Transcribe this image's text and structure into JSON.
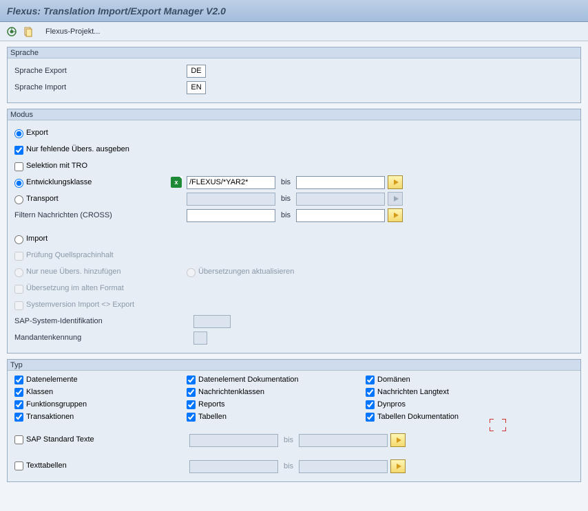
{
  "title": "Flexus: Translation Import/Export Manager V2.0",
  "toolbar": {
    "project_label": "Flexus-Projekt..."
  },
  "groups": {
    "sprache": "Sprache",
    "modus": "Modus",
    "typ": "Typ"
  },
  "sprache": {
    "export_label": "Sprache Export",
    "export_value": "DE",
    "import_label": "Sprache Import",
    "import_value": "EN"
  },
  "modus": {
    "export_radio": "Export",
    "only_missing": "Nur fehlende Übers. ausgeben",
    "sel_tro": "Selektion mit TRO",
    "devclass_radio": "Entwicklungsklasse",
    "devclass_value": "/FLEXUS/*YAR2*",
    "transport_radio": "Transport",
    "filter_msg_label": "Filtern Nachrichten (CROSS)",
    "bis": "bis",
    "import_radio": "Import",
    "check_src": "Prüfung Quellsprachinhalt",
    "only_new": "Nur neue Übers. hinzufügen",
    "upd_trans": "Übersetzungen aktualisieren",
    "old_format": "Übersetzung im alten Format",
    "sysver": "Systemversion Import <> Export",
    "sap_sys_id_label": "SAP-System-Identifikation",
    "mandant_label": "Mandantenkennung"
  },
  "typ": {
    "c1": [
      "Datenelemente",
      "Klassen",
      "Funktionsgruppen",
      "Transaktionen"
    ],
    "c2": [
      "Datenelement Dokumentation",
      "Nachrichtenklassen",
      "Reports",
      "Tabellen"
    ],
    "c3": [
      "Domänen",
      "Nachrichten Langtext",
      "Dynpros",
      "Tabellen Dokumentation"
    ],
    "sap_std_texts": "SAP Standard Texte",
    "text_tables": "Texttabellen",
    "bis": "bis"
  }
}
